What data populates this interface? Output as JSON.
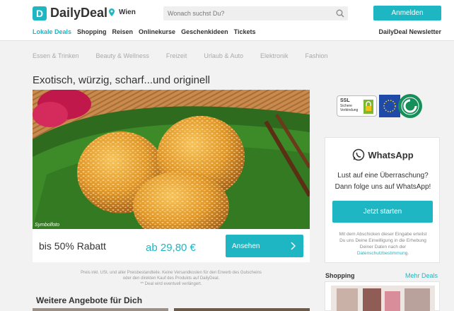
{
  "header": {
    "logo_text": "DailyDeal",
    "logo_mark": "D",
    "city": "Wien",
    "search_placeholder": "Wonach suchst Du?",
    "login_label": "Anmelden",
    "newsletter_label": "DailyDeal Newsletter",
    "nav": [
      "Lokale Deals",
      "Shopping",
      "Reisen",
      "Onlinekurse",
      "Geschenkideen",
      "Tickets"
    ]
  },
  "categories": [
    "Essen & Trinken",
    "Beauty & Wellness",
    "Freizeit",
    "Urlaub & Auto",
    "Elektronik",
    "Fashion"
  ],
  "deal": {
    "title": "Exotisch, würzig, scharf...und originell",
    "image_caption": "Symbolfoto",
    "discount": "bis 50% Rabatt",
    "price": "ab 29,80 €",
    "button_label": "Ansehen",
    "disclaimer_1": "Preis inkl. USt. und aller Preisbestandteile. Keine Versandkosten für den Erwerb des Gutscheins",
    "disclaimer_2": "oder den direkten Kauf des Produkts auf DailyDeal.",
    "disclaimer_3": "** Deal wird eventuell verlängert."
  },
  "more_offers_title": "Weitere Angebote für Dich",
  "badges": {
    "ssl_title": "SSL",
    "ssl_line1": "Sichere",
    "ssl_line2": "Verbindung"
  },
  "whatsapp": {
    "title": "WhatsApp",
    "line1": "Lust auf eine Überraschung?",
    "line2": "Dann folge uns auf WhatsApp!",
    "button_label": "Jetzt starten",
    "note_1": "Mit dem Abschicken dieser Eingabe erteilst",
    "note_2": "Du uns Deine Einwilligung in die Erhebung",
    "note_3": "Deiner Daten nach der",
    "note_link": "Datenschutzbestimmung",
    "note_end": "."
  },
  "shopping": {
    "title": "Shopping",
    "more_label": "Mehr Deals"
  },
  "colors": {
    "accent": "#1fb6c3",
    "background": "#f2f2f2"
  }
}
